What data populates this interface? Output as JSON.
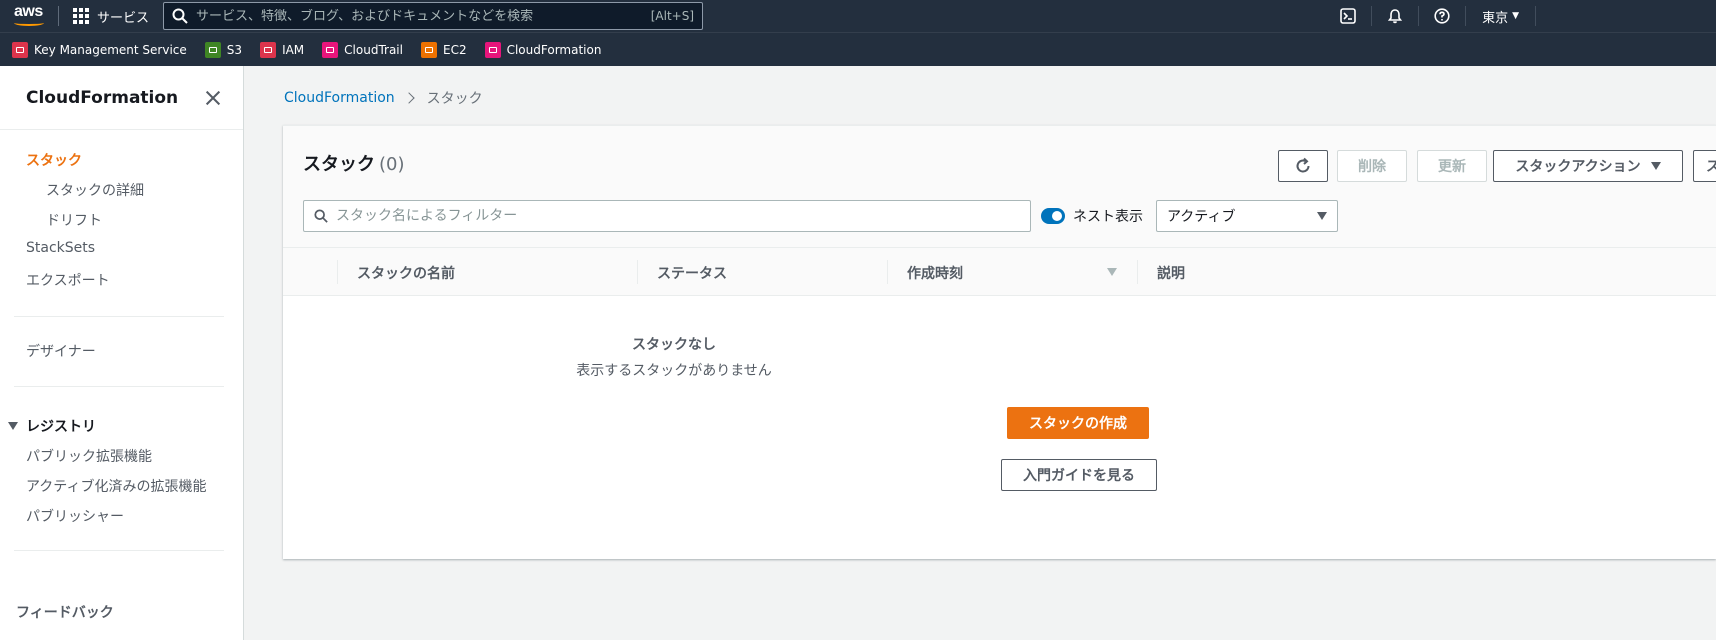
{
  "topbar": {
    "logo": "aws",
    "services_label": "サービス",
    "search_placeholder": "サービス、特徴、ブログ、およびドキュメントなどを検索",
    "search_hint": "[Alt+S]",
    "region": "東京"
  },
  "favorites": [
    {
      "label": "Key Management Service",
      "color": "#dd344c"
    },
    {
      "label": "S3",
      "color": "#3f8624"
    },
    {
      "label": "IAM",
      "color": "#dd344c"
    },
    {
      "label": "CloudTrail",
      "color": "#e7157b"
    },
    {
      "label": "EC2",
      "color": "#ed7100"
    },
    {
      "label": "CloudFormation",
      "color": "#e7157b"
    }
  ],
  "sidebar": {
    "title": "CloudFormation",
    "items": {
      "stacks": "スタック",
      "stack_details": "スタックの詳細",
      "drift": "ドリフト",
      "stacksets": "StackSets",
      "exports": "エクスポート",
      "designer": "デザイナー",
      "registry": "レジストリ",
      "public_ext": "パブリック拡張機能",
      "active_ext": "アクティブ化済みの拡張機能",
      "publisher": "パブリッシャー"
    },
    "feedback": "フィードバック"
  },
  "breadcrumb": {
    "root": "CloudFormation",
    "current": "スタック"
  },
  "panel": {
    "title": "スタック",
    "count": "(0)",
    "buttons": {
      "delete": "削除",
      "update": "更新",
      "actions": "スタックアクション",
      "create_partial": "ス"
    },
    "filter_placeholder": "スタック名によるフィルター",
    "nested_label": "ネスト表示",
    "status_select": "アクティブ",
    "columns": {
      "name": "スタックの名前",
      "status": "ステータス",
      "created": "作成時刻",
      "description": "説明"
    },
    "empty": {
      "title": "スタックなし",
      "subtitle": "表示するスタックがありません",
      "create_button": "スタックの作成",
      "guide_button": "入門ガイドを見る"
    }
  }
}
